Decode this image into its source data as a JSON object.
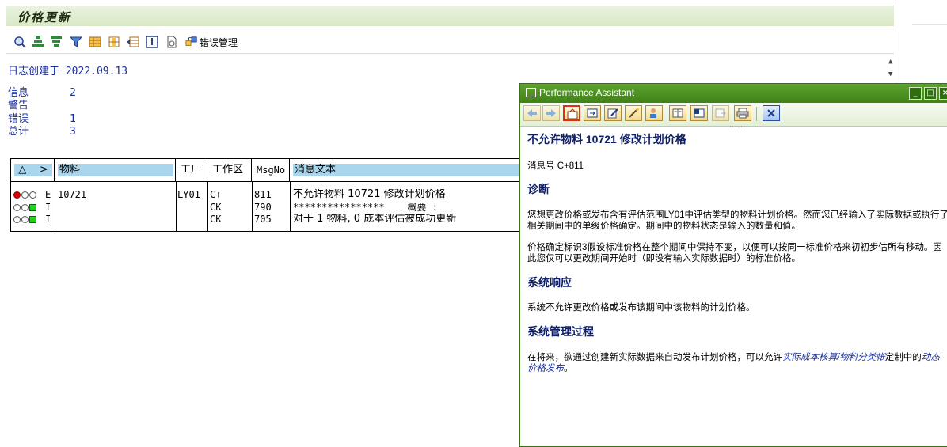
{
  "window": {
    "title": "价格更新"
  },
  "toolbar": {
    "error_mgmt_label": "错误管理"
  },
  "log": {
    "created_label": "日志创建于",
    "created_date": "2022.09.13",
    "summary": [
      {
        "label": "信息",
        "value": "2"
      },
      {
        "label": "警告",
        "value": ""
      },
      {
        "label": "错误",
        "value": "1"
      },
      {
        "label": "总计",
        "value": "3"
      }
    ]
  },
  "table": {
    "headers": {
      "sort": "△",
      "arrow": ">",
      "material": "物料",
      "plant": "工厂",
      "work_area": "工作区",
      "msgno": "MsgNo",
      "msg_text": "消息文本"
    },
    "rows": [
      {
        "light": "red",
        "type": "E",
        "material": "10721",
        "plant": "LY01",
        "work_area": "C+",
        "msgno": "811",
        "text": "不允许物料 10721  修改计划价格"
      },
      {
        "light": "green",
        "type": "I",
        "material": "",
        "plant": "",
        "work_area": "CK",
        "msgno": "790",
        "text": "****************    概要 :"
      },
      {
        "light": "green",
        "type": "I",
        "material": "",
        "plant": "",
        "work_area": "CK",
        "msgno": "705",
        "text": "对于 1 物料, 0 成本评估被成功更新"
      }
    ]
  },
  "performance_assistant": {
    "title": "Performance Assistant",
    "heading": "不允许物料 10721  修改计划价格",
    "msg_number": "消息号 C+811",
    "section_diagnosis": "诊断",
    "diagnosis_p1": "您想更改价格或发布含有评估范围LY01中评估类型的物料计划价格。然而您已经输入了实际数据或执行了相关期间中的单级价格确定。期间中的物料状态是输入的数量和值。",
    "diagnosis_p2": "价格确定标识3假设标准价格在整个期间中保持不变，以便可以按同一标准价格来初初步估所有移动。因此您仅可以更改期间开始时（即没有输入实际数据时）的标准价格。",
    "section_response": "系统响应",
    "response_p": "系统不允许更改价格或发布该期间中该物料的计划价格。",
    "section_admin": "系统管理过程",
    "admin_p_a": "在将来，欲通过创建新实际数据来自动发布计划价格，可以允许",
    "admin_link1": "实际成本核算/物料分类帐",
    "admin_p_b": "定制中的",
    "admin_link2": "动态价格发布",
    "admin_p_c": "。"
  },
  "colors": {
    "title_green": "#3f8318",
    "header_blue": "#a9d6ec",
    "text_blue": "#1b2e9a",
    "heading_navy": "#0f2069"
  }
}
